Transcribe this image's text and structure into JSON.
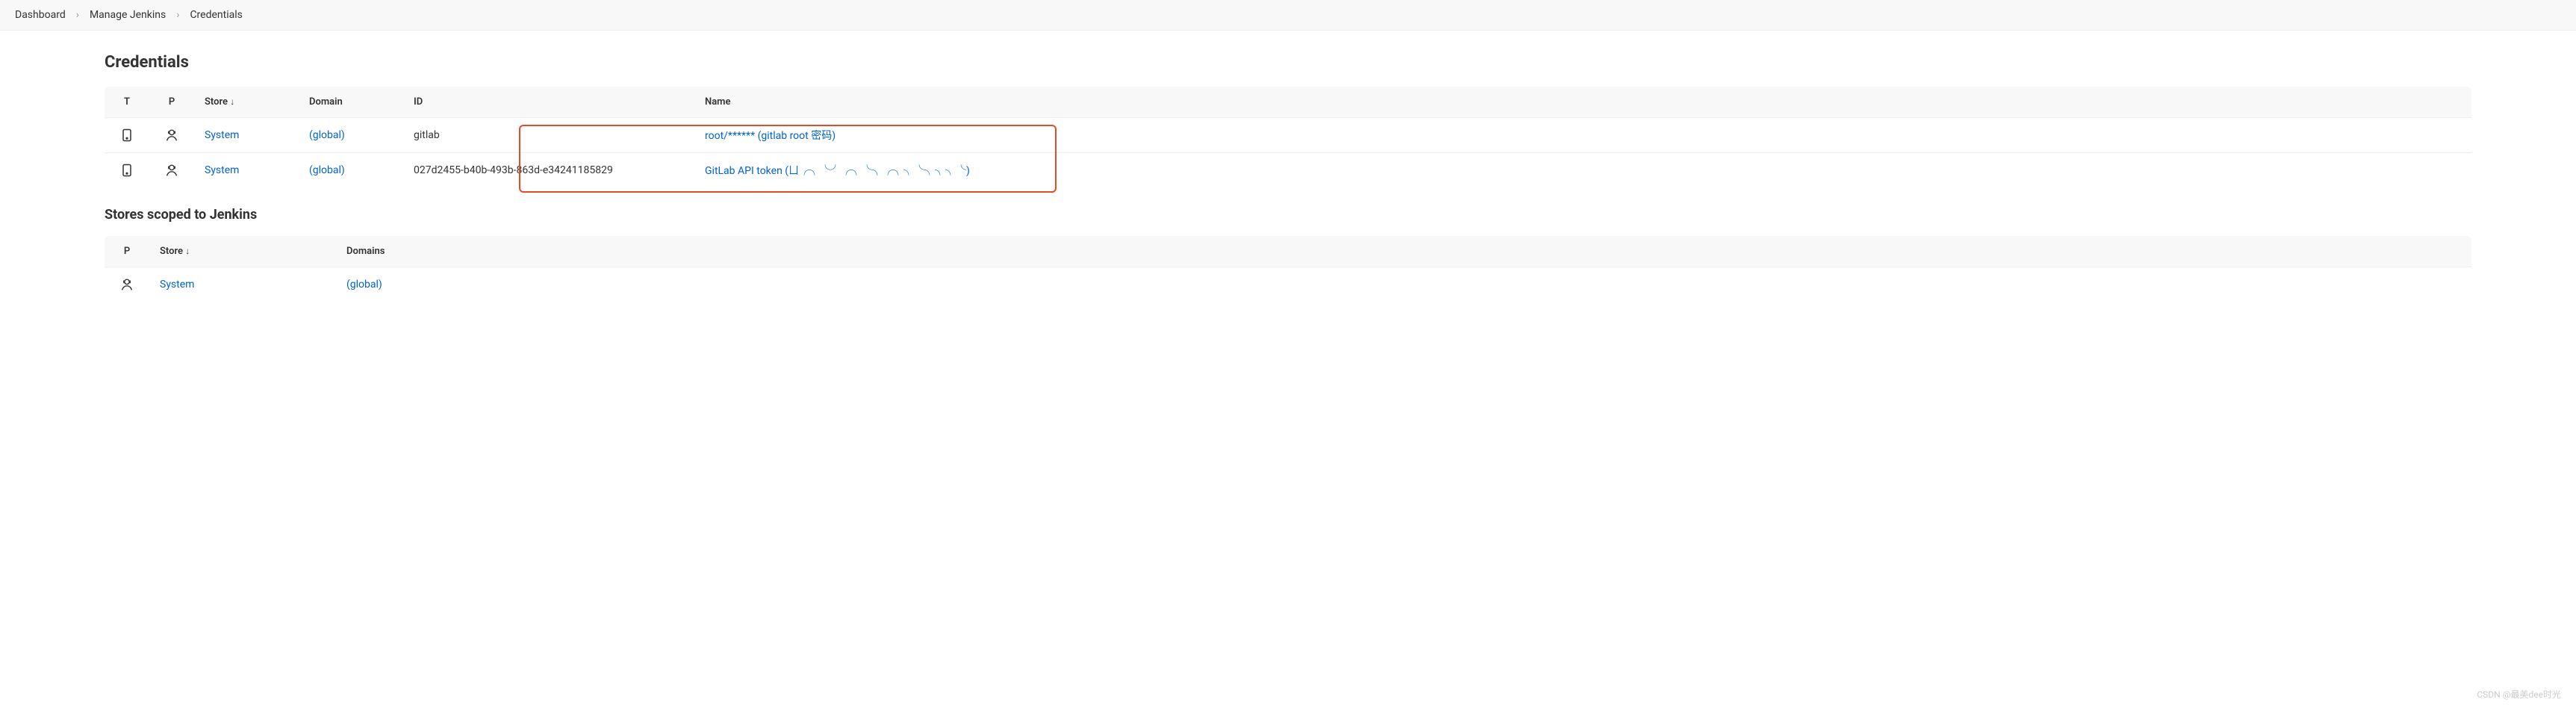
{
  "breadcrumb": [
    {
      "label": "Dashboard"
    },
    {
      "label": "Manage Jenkins"
    },
    {
      "label": "Credentials"
    }
  ],
  "page_title": "Credentials",
  "table1": {
    "headers": {
      "t": "T",
      "p": "P",
      "store": "Store",
      "sort": "↓",
      "domain": "Domain",
      "id": "ID",
      "name": "Name"
    },
    "rows": [
      {
        "store": "System",
        "domain": "(global)",
        "id": "gitlab",
        "name": "root/****** (gitlab root 密码)"
      },
      {
        "store": "System",
        "domain": "(global)",
        "id": "027d2455-b40b-493b-863d-e34241185829",
        "name": "GitLab API token (ㄩ╭╮╰╯╭╮╰╮╭╮╮╰╮╮╮╰)"
      }
    ]
  },
  "section2_title": "Stores scoped to Jenkins",
  "table2": {
    "headers": {
      "p": "P",
      "store": "Store",
      "sort": "↓",
      "domains": "Domains"
    },
    "rows": [
      {
        "store": "System",
        "domain": "(global)"
      }
    ]
  },
  "watermark": "CSDN @最美dee时光"
}
